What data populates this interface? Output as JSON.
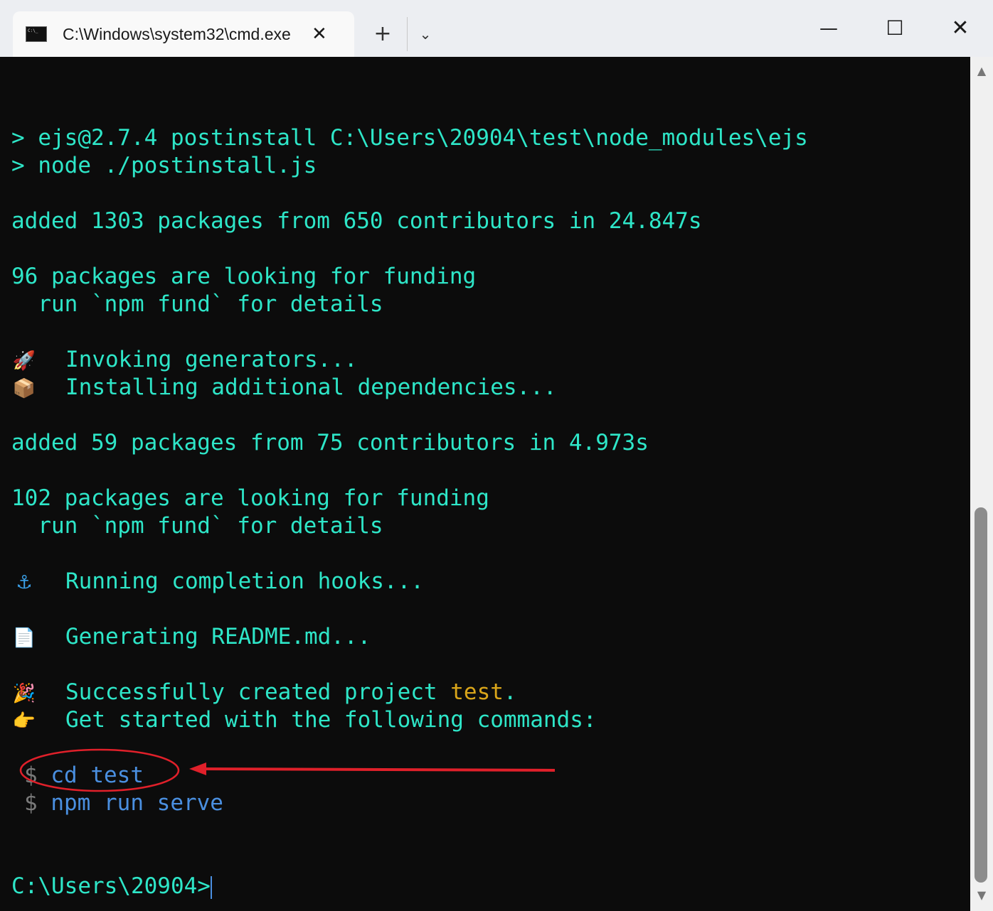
{
  "window": {
    "tab_title": "C:\\Windows\\system32\\cmd.exe",
    "close_tab_glyph": "✕",
    "new_tab_glyph": "+",
    "dropdown_glyph": "⌄",
    "minimize_glyph": "—",
    "maximize_glyph": "☐",
    "close_glyph": "✕"
  },
  "terminal": {
    "lines": [
      "> ejs@2.7.4 postinstall C:\\Users\\20904\\test\\node_modules\\ejs",
      "> node ./postinstall.js",
      "added 1303 packages from 650 contributors in 24.847s",
      "96 packages are looking for funding",
      "  run `npm fund` for details",
      "added 59 packages from 75 contributors in 4.973s",
      "102 packages are looking for funding",
      "  run `npm fund` for details"
    ],
    "steps": {
      "invoking": {
        "icon": "🚀",
        "text": "Invoking generators..."
      },
      "installing": {
        "icon": "📦",
        "text": "Installing additional dependencies..."
      },
      "hooks": {
        "icon": "⚓",
        "text": "Running completion hooks..."
      },
      "readme": {
        "icon": "📄",
        "text": "Generating README.md..."
      },
      "success": {
        "icon": "🎉",
        "text_before": "Successfully created project ",
        "project": "test",
        "text_after": "."
      },
      "get_started": {
        "icon": "👉",
        "text": "Get started with the following commands:"
      }
    },
    "commands": [
      {
        "prompt": "$",
        "cmd": "cd test"
      },
      {
        "prompt": "$",
        "cmd": "npm run serve"
      }
    ],
    "prompt": "C:\\Users\\20904>"
  },
  "colors": {
    "text": "#2ee6c8",
    "highlight": "#d9a51a",
    "command": "#4a8fe0",
    "annotation": "#e0202a"
  }
}
